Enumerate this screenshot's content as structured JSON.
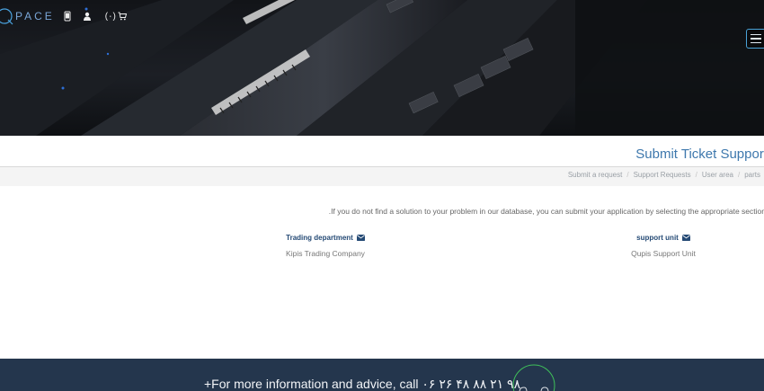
{
  "header": {
    "logo_text": "PACE",
    "cart_label": "(٠)",
    "icons": [
      "mobile-icon",
      "user-icon",
      "cart-icon",
      "hamburger-menu-icon"
    ]
  },
  "page": {
    "title": "Submit Ticket Support"
  },
  "breadcrumb": {
    "items": [
      "Submit a request",
      "Support Requests",
      "User area",
      "parts"
    ],
    "separator": "/"
  },
  "main": {
    "intro": ".If you do not find a solution to your problem in our database, you can submit your application by selecting the appropriate section",
    "departments": [
      {
        "name": "Trading department",
        "company": "Kipis Trading Company"
      },
      {
        "name": "support unit",
        "company": "Qupis Support Unit"
      }
    ]
  },
  "footer": {
    "info_text": "+For more information and advice, call ٠۶ ۲۶ ۴۸ ۸۸ ۲۱ ۹۸"
  },
  "colors": {
    "accent": "#3e78ad",
    "dept_title": "#254a75",
    "footer_bg": "#24364d",
    "support_ring": "#3fbf5a"
  }
}
